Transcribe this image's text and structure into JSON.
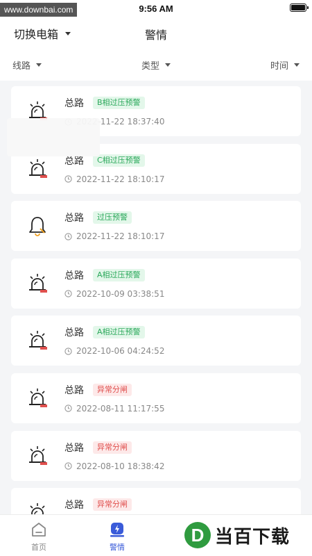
{
  "status_bar": {
    "time": "9:56 AM",
    "watermark": "www.downbai.com"
  },
  "header": {
    "switch_label": "切换电箱",
    "title": "警情"
  },
  "filters": [
    {
      "label": "线路"
    },
    {
      "label": "类型"
    },
    {
      "label": "时间"
    }
  ],
  "alerts": [
    {
      "source": "总路",
      "badge": "B相过压预警",
      "badge_color": "green",
      "time": "2022-11-22 18:37:40",
      "icon": "siren-icon"
    },
    {
      "source": "总路",
      "badge": "C相过压预警",
      "badge_color": "green",
      "time": "2022-11-22 18:10:17",
      "icon": "siren-icon"
    },
    {
      "source": "总路",
      "badge": "过压预警",
      "badge_color": "green",
      "time": "2022-11-22 18:10:17",
      "icon": "bell-icon"
    },
    {
      "source": "总路",
      "badge": "A相过压预警",
      "badge_color": "green",
      "time": "2022-10-09 03:38:51",
      "icon": "siren-icon"
    },
    {
      "source": "总路",
      "badge": "A相过压预警",
      "badge_color": "green",
      "time": "2022-10-06 04:24:52",
      "icon": "siren-icon"
    },
    {
      "source": "总路",
      "badge": "异常分闸",
      "badge_color": "red",
      "time": "2022-08-11 11:17:55",
      "icon": "siren-icon"
    },
    {
      "source": "总路",
      "badge": "异常分闸",
      "badge_color": "red",
      "time": "2022-08-10 18:38:42",
      "icon": "siren-icon"
    },
    {
      "source": "总路",
      "badge": "异常分闸",
      "badge_color": "red",
      "time": "",
      "icon": "siren-icon"
    }
  ],
  "tabs": [
    {
      "label": "首页",
      "icon": "home-icon"
    },
    {
      "label": "警情",
      "icon": "alert-icon",
      "active": true
    }
  ],
  "watermark_logo": {
    "letter": "D",
    "text": "当百下载"
  },
  "colors": {
    "accent": "#3a5bd9",
    "badge_green": "#2aa85a",
    "badge_red": "#e0504e"
  }
}
